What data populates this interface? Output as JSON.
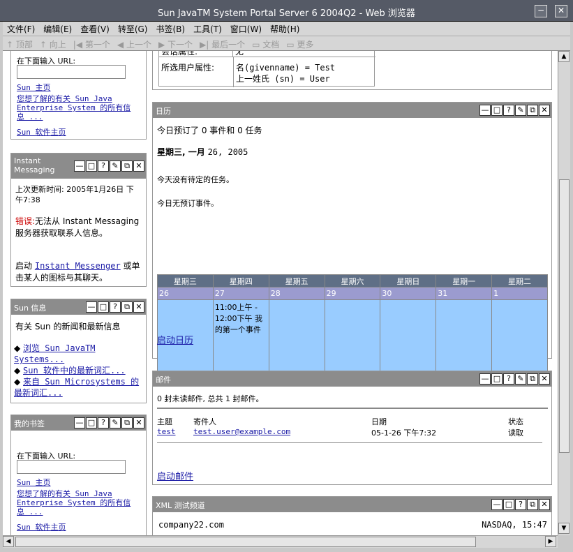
{
  "window": {
    "title": "Sun JavaTM System Portal Server 6 2004Q2 - Web 浏览器",
    "btn_min": "−",
    "btn_max": "□",
    "btn_close": "✕"
  },
  "menu": [
    "文件(F)",
    "编辑(E)",
    "查看(V)",
    "转至(G)",
    "书签(B)",
    "工具(T)",
    "窗口(W)",
    "帮助(H)"
  ],
  "nav": [
    "顶部",
    "向上",
    "第一个",
    "上一个",
    "下一个",
    "最后一个",
    "文档",
    "更多"
  ],
  "bookmarks_top": {
    "label": "在下面输入 URL:",
    "link1": "Sun 主页",
    "link2": "您想了解的有关 Sun Java Enterprise System 的所有信息 ...",
    "link3": "Sun 软件主页"
  },
  "im": {
    "title": "Instant Messaging",
    "updated": "上次更新时间: 2005年1月26日 下午7:38",
    "err_label": "错误:",
    "err_text": "无法从 Instant Messaging 服务器获取联系人信息。",
    "start_a": "启动",
    "start_link": "Instant Messenger",
    "start_b": "或单击某人的图标与其聊天。"
  },
  "suninfo": {
    "title": "Sun 信息",
    "desc": "有关 Sun 的新闻和最新信息",
    "items": [
      "浏览 Sun JavaTM Systems...",
      "Sun 软件中的最新词汇...",
      "来自 Sun Microsystems 的最新词汇..."
    ]
  },
  "mybookmarks": {
    "title": "我的书签",
    "label": "在下面输入 URL:",
    "link1": "Sun 主页",
    "link2": "您想了解的有关 Sun Java Enterprise System 的所有信息 ...",
    "link3": "Sun 软件主页"
  },
  "userinfo": {
    "cut_label": "会话属性:",
    "cut_value": "无",
    "label": "所选用户属性:",
    "v1": "名(givenname) = Test",
    "v2": "上一姓氏 (sn) = User"
  },
  "calendar": {
    "title": "日历",
    "summary": "今日预订了 0 事件和 0 任务",
    "date_bold": "星期三, 一月",
    "date_rest": "26, 2005",
    "no_tasks": "今天没有待定的任务。",
    "no_events": "今日无预订事件。",
    "days": [
      "星期三",
      "星期四",
      "星期五",
      "星期六",
      "星期日",
      "星期一",
      "星期二"
    ],
    "dates": [
      "26",
      "27",
      "28",
      "29",
      "30",
      "31",
      "1"
    ],
    "event": "11:00上午 - 12:00下午 我的第一个事件",
    "launch": "启动日历"
  },
  "mail": {
    "title": "邮件",
    "summary": "0 封未读邮件, 总共 1 封邮件。",
    "headers": [
      "主题",
      "寄件人",
      "日期",
      "状态"
    ],
    "row": [
      "test",
      "test.user@example.com",
      "05-1-26 下午7:32",
      "读取"
    ],
    "launch": "启动邮件"
  },
  "xml": {
    "title": "XML 测试频道",
    "company": "company22.com",
    "market": "NASDAQ, 15:47"
  },
  "controls": [
    "—",
    "□",
    "?",
    "✎",
    "⧉",
    "✕"
  ]
}
